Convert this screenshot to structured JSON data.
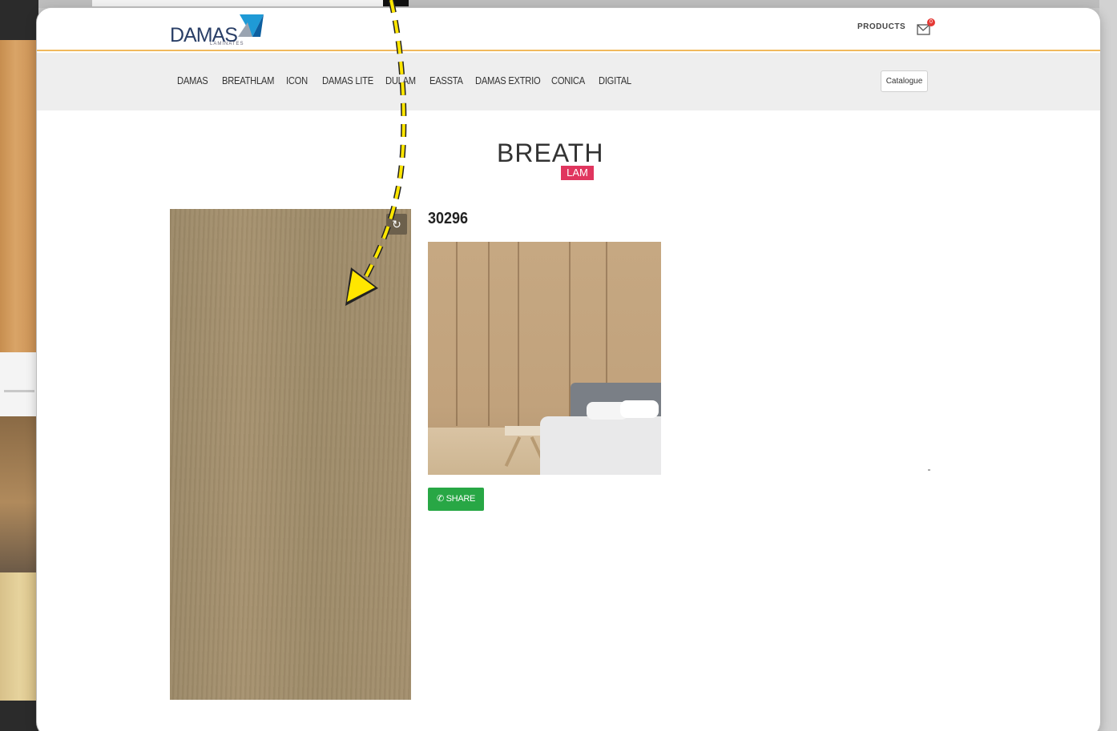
{
  "header": {
    "logo_text": "DAMAS",
    "logo_subtitle": "LAMINATES",
    "products_label": "PRODUCTS",
    "cart_count": "0"
  },
  "nav": {
    "items": [
      "DAMAS",
      "BREATHLAM",
      "ICON",
      "DAMAS LITE",
      "DULAM",
      "EASSTA",
      "DAMAS EXTRIO",
      "CONICA",
      "DIGITAL"
    ],
    "catalogue_label": "Catalogue"
  },
  "brand": {
    "name": "BREATH",
    "sub": "LAM"
  },
  "product": {
    "code": "30296",
    "share_label": "SHARE",
    "rotate_icon": "↻"
  },
  "colors": {
    "accent_line": "#f0b95d",
    "share_green": "#28a745",
    "brand_pink": "#e0355e",
    "logo_blue": "#2a3f67",
    "arrow_yellow": "#ffe600"
  }
}
